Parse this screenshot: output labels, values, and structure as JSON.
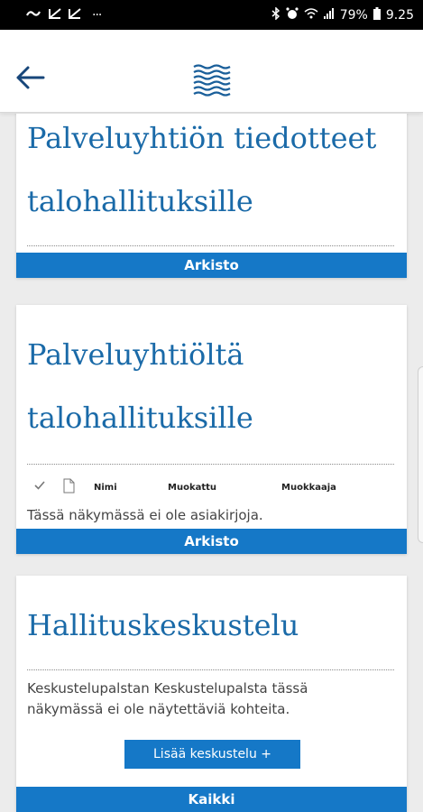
{
  "status_bar": {
    "left_icons": [
      "link-icon",
      "image-icon",
      "image-icon",
      "more-icon"
    ],
    "more": "···",
    "battery": "79%",
    "time": "9.25"
  },
  "app_bar": {
    "back_icon": "arrow-left-icon",
    "logo_icon": "wave-logo-icon"
  },
  "cards": [
    {
      "title_line1": "Palveluyhtiön tiedotteet",
      "title_line2": "talohallituksille",
      "button": "Arkisto"
    },
    {
      "title_line1": "Palveluyhtiöltä",
      "title_line2": "talohallituksille",
      "columns": [
        "Nimi",
        "Muokattu",
        "Muokkaaja"
      ],
      "empty_text": "Tässä näkymässä ei ole asiakirjoja.",
      "button": "Arkisto"
    },
    {
      "title": "Hallituskeskustelu",
      "empty_text_line1": "Keskustelupalstan Keskustelupalsta tässä",
      "empty_text_line2": "näkymässä ei ole näytettäviä kohteita.",
      "add_button": "Lisää keskustelu +",
      "button": "Kaikki"
    }
  ],
  "colors": {
    "accent": "#1578c7",
    "title": "#1a6aa8",
    "logo": "#1a5f9a"
  }
}
